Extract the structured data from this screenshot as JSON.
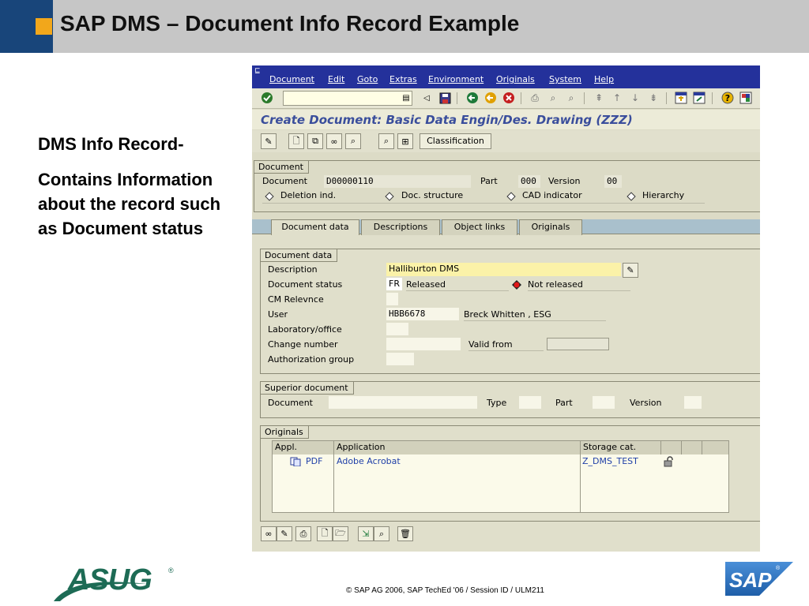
{
  "slide": {
    "title": "SAP DMS – Document Info Record Example",
    "left_heading": "DMS Info Record-",
    "left_body": "Contains Information about the record such as Document status",
    "footer": "© SAP AG 2006, SAP TechEd '06 / Session ID / ULM211",
    "asug_logo": "ASUG",
    "asug_reg": "®",
    "sap_logo": "SAP",
    "sap_reg": "®"
  },
  "sap": {
    "menu": [
      "Document",
      "Edit",
      "Goto",
      "Extras",
      "Environment",
      "Originals",
      "System",
      "Help"
    ],
    "screen_title": "Create Document: Basic Data Engin/Des. Drawing (ZZZ)",
    "classification_button": "Classification",
    "document_frame": {
      "title": "Document",
      "document_label": "Document",
      "document_value": "D00000110",
      "part_label": "Part",
      "part_value": "000",
      "version_label": "Version",
      "version_value": "00",
      "options": [
        "Deletion ind.",
        "Doc. structure",
        "CAD indicator",
        "Hierarchy"
      ]
    },
    "tabs": [
      "Document data",
      "Descriptions",
      "Object links",
      "Originals"
    ],
    "document_data": {
      "title": "Document data",
      "description_label": "Description",
      "description_value": "Halliburton DMS",
      "status_label": "Document status",
      "status_code": "FR",
      "status_text": "Released",
      "not_released": "Not released",
      "cm_label": "CM Relevnce",
      "user_label": "User",
      "user_value": "HBB6678",
      "user_name": "Breck Whitten , ESG",
      "lab_label": "Laboratory/office",
      "change_label": "Change number",
      "valid_from_label": "Valid from",
      "auth_label": "Authorization group"
    },
    "superior": {
      "title": "Superior document",
      "document_label": "Document",
      "type_label": "Type",
      "part_label": "Part",
      "version_label": "Version"
    },
    "originals": {
      "title": "Originals",
      "columns": [
        "Appl.",
        "Application",
        "Storage cat."
      ],
      "row": {
        "appl": "PDF",
        "application": "Adobe Acrobat",
        "storage": "Z_DMS_TEST"
      }
    }
  },
  "colors": {
    "header_gray": "#c6c6c6",
    "header_blue": "#18457a",
    "header_orange": "#f2a71b",
    "sap_menubar": "#24319b",
    "sap_background": "#dcdbc6",
    "sap_title_text": "#3a4e9c",
    "asug_green": "#1d6b55",
    "sap_logo_blue": "#1f5ea8"
  },
  "icons": [
    "check-icon",
    "save-icon",
    "back-icon",
    "exit-icon",
    "cancel-icon",
    "print-icon",
    "find-icon",
    "help-icon",
    "edit-icon",
    "new-icon",
    "pencil-icon",
    "trash-icon"
  ]
}
